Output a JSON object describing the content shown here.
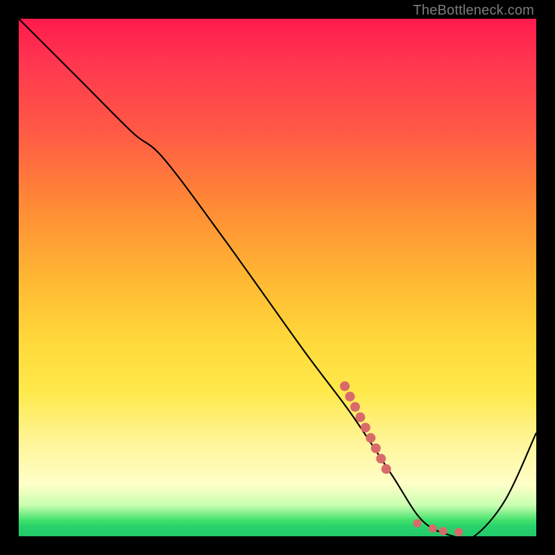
{
  "watermark": "TheBottleneck.com",
  "chart_data": {
    "type": "line",
    "title": "",
    "xlabel": "",
    "ylabel": "",
    "xlim": [
      0,
      100
    ],
    "ylim": [
      0,
      100
    ],
    "series": [
      {
        "name": "curve",
        "x": [
          0,
          12,
          22,
          28,
          40,
          55,
          64,
          72,
          78,
          84,
          88,
          94,
          100
        ],
        "values": [
          100,
          88,
          78,
          73,
          57,
          36,
          24,
          12,
          3,
          0,
          0,
          7,
          20
        ]
      }
    ],
    "markers": {
      "name": "highlight-cluster",
      "color": "#d96a6a",
      "points": [
        {
          "x": 63,
          "y": 29
        },
        {
          "x": 64,
          "y": 27
        },
        {
          "x": 65,
          "y": 25
        },
        {
          "x": 66,
          "y": 23
        },
        {
          "x": 67,
          "y": 21
        },
        {
          "x": 68,
          "y": 19
        },
        {
          "x": 69,
          "y": 17
        },
        {
          "x": 70,
          "y": 15
        },
        {
          "x": 71,
          "y": 13
        },
        {
          "x": 77,
          "y": 2.5
        },
        {
          "x": 80,
          "y": 1.5
        },
        {
          "x": 82,
          "y": 1
        },
        {
          "x": 85,
          "y": 0.8
        }
      ]
    },
    "background_gradient": [
      "#ff1a4d",
      "#ffb733",
      "#fff59a",
      "#2ad36c"
    ]
  }
}
